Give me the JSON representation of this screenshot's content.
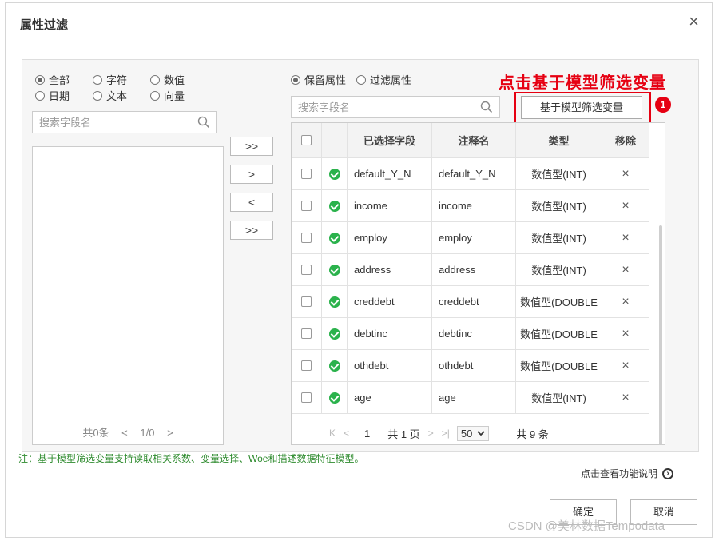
{
  "dialog": {
    "title": "属性过滤",
    "close_glyph": "×",
    "left": {
      "radios": [
        {
          "label": "全部",
          "checked": true
        },
        {
          "label": "字符",
          "checked": false
        },
        {
          "label": "数值",
          "checked": false
        },
        {
          "label": "日期",
          "checked": false
        },
        {
          "label": "文本",
          "checked": false
        },
        {
          "label": "向量",
          "checked": false
        }
      ],
      "search_placeholder": "搜索字段名",
      "pager": {
        "total": "共0条",
        "prev": "<",
        "page": "1/0",
        "next": ">"
      }
    },
    "move_buttons": [
      ">>",
      ">",
      "<",
      ">>"
    ],
    "right": {
      "radios": [
        {
          "label": "保留属性",
          "checked": true
        },
        {
          "label": "过滤属性",
          "checked": false
        }
      ],
      "search_placeholder": "搜索字段名",
      "annotation": "点击基于模型筛选变量",
      "model_filter_button": "基于模型筛选变量",
      "badge": "1",
      "table": {
        "headers": [
          "已选择字段",
          "注释名",
          "类型",
          "移除"
        ],
        "rows": [
          {
            "field": "default_Y_N",
            "alias": "default_Y_N",
            "type": "数值型(INT)"
          },
          {
            "field": "income",
            "alias": "income",
            "type": "数值型(INT)"
          },
          {
            "field": "employ",
            "alias": "employ",
            "type": "数值型(INT)"
          },
          {
            "field": "address",
            "alias": "address",
            "type": "数值型(INT)"
          },
          {
            "field": "creddebt",
            "alias": "creddebt",
            "type": "数值型(DOUBLE"
          },
          {
            "field": "debtinc",
            "alias": "debtinc",
            "type": "数值型(DOUBLE"
          },
          {
            "field": "othdebt",
            "alias": "othdebt",
            "type": "数值型(DOUBLE"
          },
          {
            "field": "age",
            "alias": "age",
            "type": "数值型(INT)"
          }
        ],
        "remove_glyph": "×"
      },
      "pager": {
        "first": "K",
        "prev": "<",
        "page": "1",
        "total_pages": "共 1 页",
        "next": ">",
        "last": ">|",
        "page_size": "50",
        "total": "共 9 条"
      }
    },
    "note": "注：基于模型筛选变量支持读取相关系数、变量选择、Woe和描述数据特征模型。",
    "help_link": "点击查看功能说明",
    "confirm": "确定",
    "cancel": "取消"
  },
  "watermark": "CSDN @美林数据Tempodata",
  "colors": {
    "annotation_red": "#e60012",
    "check_green": "#2bb24c",
    "note_green": "#2e8b2e"
  }
}
